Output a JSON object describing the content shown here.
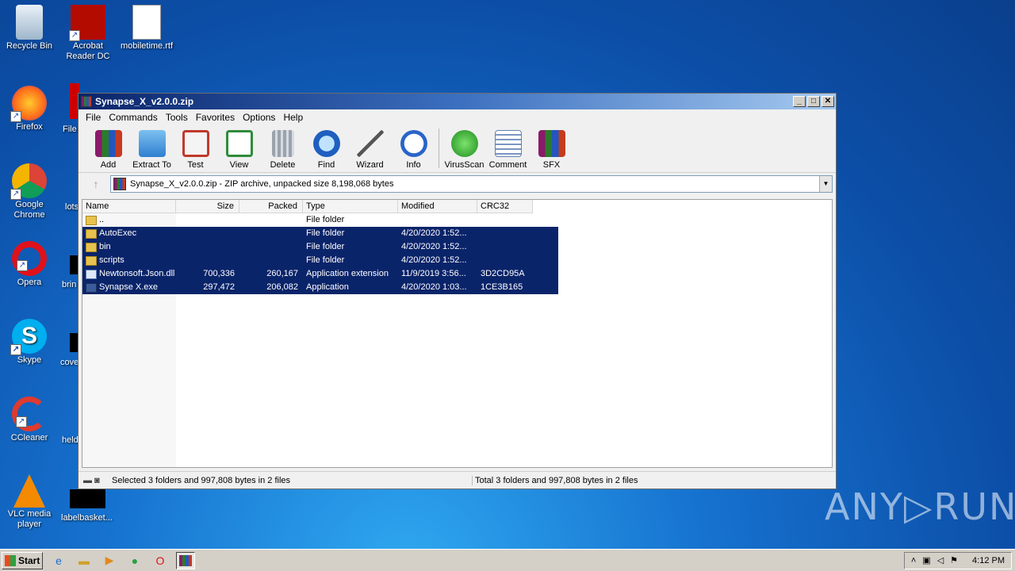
{
  "desktop": {
    "icons": [
      {
        "label": "Recycle Bin"
      },
      {
        "label": "Acrobat Reader DC"
      },
      {
        "label": "mobiletime.rtf"
      },
      {
        "label": "Firefox"
      },
      {
        "label": "Google Chrome"
      },
      {
        "label": "Opera"
      },
      {
        "label": "Skype"
      },
      {
        "label": "CCleaner"
      },
      {
        "label": "VLC media player"
      }
    ],
    "partial_labels": [
      "File",
      "lots",
      "brin",
      "cove",
      "held",
      "labelbasket..."
    ]
  },
  "window": {
    "title": "Synapse_X_v2.0.0.zip",
    "menu": [
      "File",
      "Commands",
      "Tools",
      "Favorites",
      "Options",
      "Help"
    ],
    "toolbar": [
      "Add",
      "Extract To",
      "Test",
      "View",
      "Delete",
      "Find",
      "Wizard",
      "Info",
      "VirusScan",
      "Comment",
      "SFX"
    ],
    "address": "Synapse_X_v2.0.0.zip - ZIP archive, unpacked size 8,198,068 bytes",
    "columns": [
      "Name",
      "Size",
      "Packed",
      "Type",
      "Modified",
      "CRC32"
    ],
    "rows": [
      {
        "name": "..",
        "size": "",
        "packed": "",
        "type": "File folder",
        "modified": "",
        "crc": "",
        "icon": "folder",
        "selected": false
      },
      {
        "name": "AutoExec",
        "size": "",
        "packed": "",
        "type": "File folder",
        "modified": "4/20/2020 1:52...",
        "crc": "",
        "icon": "folder",
        "selected": true
      },
      {
        "name": "bin",
        "size": "",
        "packed": "",
        "type": "File folder",
        "modified": "4/20/2020 1:52...",
        "crc": "",
        "icon": "folder",
        "selected": true
      },
      {
        "name": "scripts",
        "size": "",
        "packed": "",
        "type": "File folder",
        "modified": "4/20/2020 1:52...",
        "crc": "",
        "icon": "folder",
        "selected": true
      },
      {
        "name": "Newtonsoft.Json.dll",
        "size": "700,336",
        "packed": "260,167",
        "type": "Application extension",
        "modified": "11/9/2019 3:56...",
        "crc": "3D2CD95A",
        "icon": "file",
        "selected": true
      },
      {
        "name": "Synapse X.exe",
        "size": "297,472",
        "packed": "206,082",
        "type": "Application",
        "modified": "4/20/2020 1:03...",
        "crc": "1CE3B165",
        "icon": "exe",
        "selected": true
      }
    ],
    "status_left": "Selected 3 folders and 997,808 bytes in 2 files",
    "status_right": "Total 3 folders and 997,808 bytes in 2 files"
  },
  "watermark": "ANY▷RUN",
  "taskbar": {
    "start_label": "Start",
    "clock": "4:12 PM"
  }
}
